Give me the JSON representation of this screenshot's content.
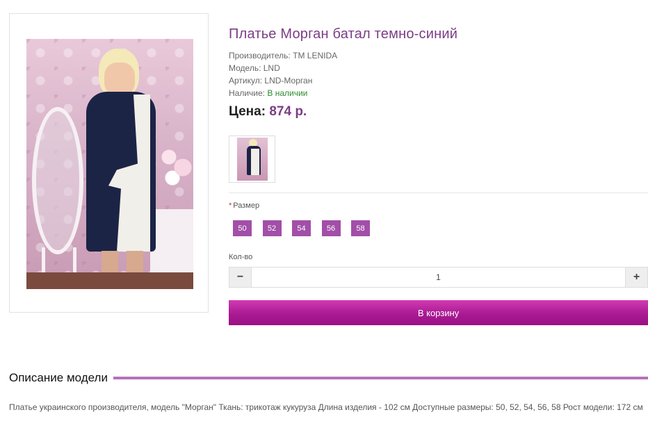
{
  "product": {
    "title": "Платье Морган батал темно-синий",
    "manufacturer_label": "Производитель:",
    "manufacturer": "TM LENIDA",
    "model_label": "Модель:",
    "model": "LND",
    "sku_label": "Артикул:",
    "sku": "LND-Морган",
    "availability_label": "Наличие:",
    "availability": "В наличии",
    "price_label": "Цена:",
    "price": "874 р."
  },
  "options": {
    "required_mark": "*",
    "size_label": "Размер",
    "sizes": [
      "50",
      "52",
      "54",
      "56",
      "58"
    ]
  },
  "quantity": {
    "label": "Кол-во",
    "value": "1",
    "minus_icon": "minus-icon",
    "plus_icon": "plus-icon"
  },
  "cart": {
    "button_label": "В корзину"
  },
  "description": {
    "heading": "Описание модели",
    "text": "Платье украинского производителя, модель \"Морган\" Ткань: трикотаж кукуруза Длина изделия - 102 см Доступные размеры: 50, 52, 54, 56, 58 Рост модели: 172 см"
  },
  "colors": {
    "accent": "#7c3c86",
    "size_button": "#a24fa8",
    "cart_button": "#b0209a",
    "in_stock": "#2e8b2e"
  }
}
